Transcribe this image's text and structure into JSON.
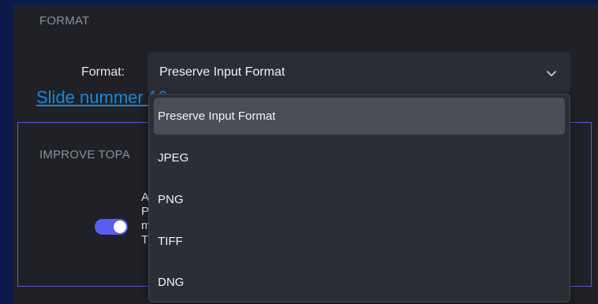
{
  "format_section": {
    "title": "FORMAT",
    "label": "Format:",
    "selected_value": "Preserve Input Format"
  },
  "slide_link": "Slide nummer 16",
  "improve_section": {
    "title": "IMPROVE TOPA",
    "toggle_on": true,
    "description_fragment": "A\nP\nm\nT"
  },
  "dropdown": {
    "options": [
      "Preserve Input Format",
      "JPEG",
      "PNG",
      "TIFF",
      "DNG"
    ],
    "selected_index": 0
  },
  "colors": {
    "background": "#0b1a4a",
    "panel": "#1f2126",
    "accent": "#5b5cf0",
    "link": "#1f86d9"
  }
}
